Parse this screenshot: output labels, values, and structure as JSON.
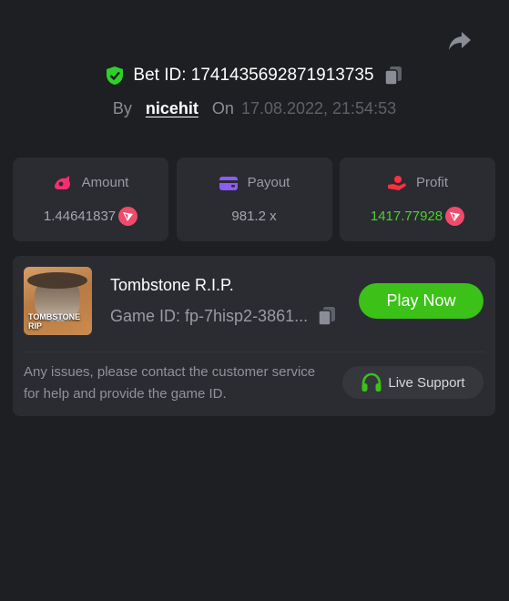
{
  "header": {
    "bet_id_label": "Bet ID: 1741435692871913735",
    "by_label": "By",
    "username": "nicehit",
    "on_label": "On",
    "timestamp": "17.08.2022, 21:54:53"
  },
  "stats": {
    "amount": {
      "label": "Amount",
      "value": "1.44641837"
    },
    "payout": {
      "label": "Payout",
      "value": "981.2 x"
    },
    "profit": {
      "label": "Profit",
      "value": "1417.77928"
    }
  },
  "game": {
    "name": "Tombstone R.I.P.",
    "game_id": "Game ID: fp-7hisp2-3861...",
    "thumbnail_title": "TOMBSTONE RIP",
    "play_label": "Play Now",
    "issue_text": "Any issues, please contact the customer service for help and provide the game ID.",
    "support_label": "Live Support"
  },
  "colors": {
    "background": "#1e1f22",
    "card": "#2a2c31",
    "accent_green": "#3bc117",
    "profit_green": "#4cd12b",
    "coin_red": "#f04b6c",
    "amount_icon": "#ff2d6f",
    "payout_icon": "#8b5cf6",
    "profit_icon": "#ff3040"
  },
  "icons": {
    "share": "share-icon",
    "verified": "shield-check-icon",
    "copy": "copy-icon",
    "amount": "bet-amount-icon",
    "payout": "wallet-icon",
    "profit": "profit-hand-icon",
    "coin": "trx-coin-icon",
    "support": "headset-icon"
  }
}
